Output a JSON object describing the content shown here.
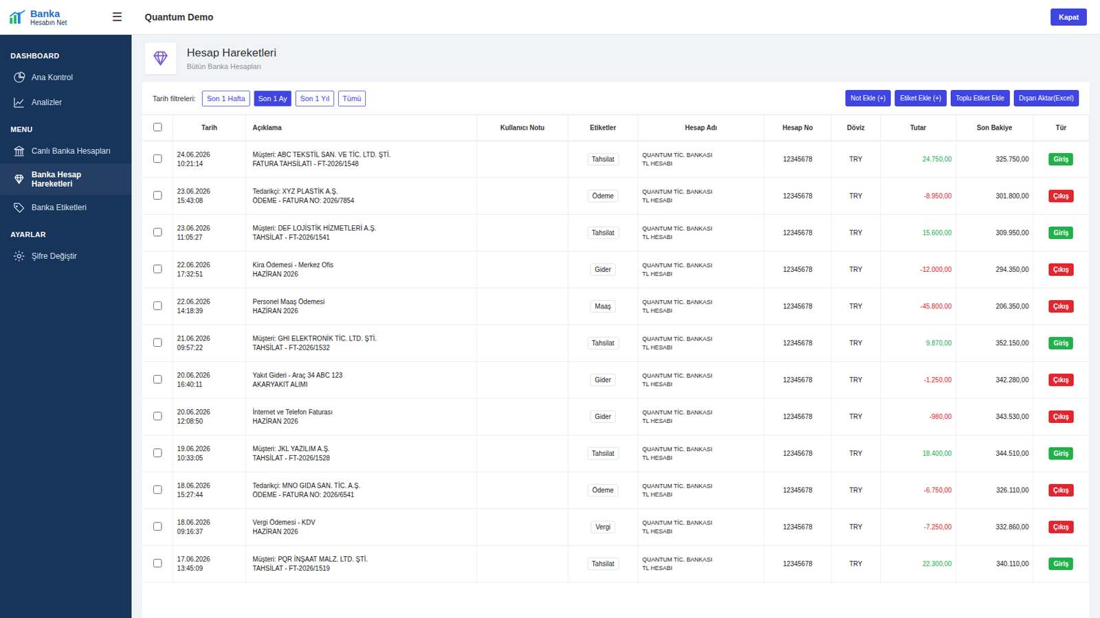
{
  "logo": {
    "title": "Banka",
    "subtitle": "Hesabın Net",
    "menu_toggle": "☰"
  },
  "sidebar": {
    "sections": [
      {
        "title": "DASHBOARD",
        "items": [
          {
            "label": "Ana Kontrol",
            "selected": false
          },
          {
            "label": "Analizler",
            "selected": false
          }
        ]
      },
      {
        "title": "MENU",
        "items": [
          {
            "label": "Canlı Banka Hesapları",
            "selected": false
          },
          {
            "label": "Banka Hesap Hareketleri",
            "selected": true
          },
          {
            "label": "Banka Etiketleri",
            "selected": false
          }
        ]
      },
      {
        "title": "AYARLAR",
        "items": [
          {
            "label": "Şifre Değiştir",
            "selected": false
          }
        ]
      }
    ]
  },
  "topbar": {
    "title": "Quantum Demo",
    "button": "Kapat"
  },
  "page": {
    "title": "Hesap Hareketleri",
    "subtitle": "Bütün Banka Hesapları"
  },
  "filters": {
    "label": "Tarih filtreleri:",
    "options": [
      {
        "label": "Son 1 Hafta",
        "selected": false
      },
      {
        "label": "Son 1 Ay",
        "selected": true
      },
      {
        "label": "Son 1 Yıl",
        "selected": false
      },
      {
        "label": "Tümü",
        "selected": false
      }
    ]
  },
  "actions": [
    "Not Ekle (+)",
    "Etiket Ekle (+)",
    "Toplu Etiket Ekle",
    "Dışarı Aktar(Excel)"
  ],
  "table": {
    "select_all_checked": false,
    "columns": [
      "Tarih",
      "Açıklama",
      "Kullanıcı Notu",
      "Etiketler",
      "Hesap Adı",
      "Hesap No",
      "Döviz",
      "Tutar",
      "Son Bakiye",
      "Tür"
    ],
    "rows": [
      {
        "checked": false,
        "date": "24.06.2026",
        "time": "10:21:14",
        "desc1": "Müşteri: ABC TEKSTİL SAN. VE TİC. LTD. ŞTİ.",
        "desc2": "FATURA TAHSİLATI - FT-2026/1548",
        "note": "",
        "tag": "Tahsilat",
        "account1": "QUANTUM TİC. BANKASI",
        "account2": "TL HESABI",
        "account_no": "12345678",
        "currency": "TRY",
        "amount": "24.750,00",
        "balance": "325.750,00",
        "type": "Giriş",
        "color": "#22b04b"
      },
      {
        "checked": false,
        "date": "23.06.2026",
        "time": "15:43:08",
        "desc1": "Tedarikçi: XYZ PLASTİK A.Ş.",
        "desc2": "ÖDEME - FATURA NO: 2026/7854",
        "note": "",
        "tag": "Ödeme",
        "account1": "QUANTUM TİC. BANKASI",
        "account2": "TL HESABI",
        "account_no": "12345678",
        "currency": "TRY",
        "amount": "-8.950,00",
        "balance": "301.800,00",
        "type": "Çıkış",
        "color": "#e0262f"
      },
      {
        "checked": false,
        "date": "23.06.2026",
        "time": "11:05:27",
        "desc1": "Müşteri: DEF LOJİSTİK HİZMETLERİ A.Ş.",
        "desc2": "TAHSİLAT - FT-2026/1541",
        "note": "",
        "tag": "Tahsilat",
        "account1": "QUANTUM TİC. BANKASI",
        "account2": "TL HESABI",
        "account_no": "12345678",
        "currency": "TRY",
        "amount": "15.600,00",
        "balance": "309.950,00",
        "type": "Giriş",
        "color": "#22b04b"
      },
      {
        "checked": false,
        "date": "22.06.2026",
        "time": "17:32:51",
        "desc1": "Kira Ödemesi - Merkez Ofis",
        "desc2": "HAZİRAN 2026",
        "note": "",
        "tag": "Gider",
        "account1": "QUANTUM TİC. BANKASI",
        "account2": "TL HESABI",
        "account_no": "12345678",
        "currency": "TRY",
        "amount": "-12.000,00",
        "balance": "294.350,00",
        "type": "Çıkış",
        "color": "#e0262f"
      },
      {
        "checked": false,
        "date": "22.06.2026",
        "time": "14:18:39",
        "desc1": "Personel Maaş Ödemesi",
        "desc2": "HAZİRAN 2026",
        "note": "",
        "tag": "Maaş",
        "account1": "QUANTUM TİC. BANKASI",
        "account2": "TL HESABI",
        "account_no": "12345678",
        "currency": "TRY",
        "amount": "-45.800,00",
        "balance": "206.350,00",
        "type": "Çıkış",
        "color": "#e0262f"
      },
      {
        "checked": false,
        "date": "21.06.2026",
        "time": "09:57:22",
        "desc1": "Müşteri: GHI ELEKTRONİK TİC. LTD. ŞTİ.",
        "desc2": "TAHSİLAT - FT-2026/1532",
        "note": "",
        "tag": "Tahsilat",
        "account1": "QUANTUM TİC. BANKASI",
        "account2": "TL HESABI",
        "account_no": "12345678",
        "currency": "TRY",
        "amount": "9.870,00",
        "balance": "352.150,00",
        "type": "Giriş",
        "color": "#22b04b"
      },
      {
        "checked": false,
        "date": "20.06.2026",
        "time": "16:40:11",
        "desc1": "Yakıt Gideri - Araç 34 ABC 123",
        "desc2": "AKARYAKIT ALIMI",
        "note": "",
        "tag": "Gider",
        "account1": "QUANTUM TİC. BANKASI",
        "account2": "TL HESABI",
        "account_no": "12345678",
        "currency": "TRY",
        "amount": "-1.250,00",
        "balance": "342.280,00",
        "type": "Çıkış",
        "color": "#e0262f"
      },
      {
        "checked": false,
        "date": "20.06.2026",
        "time": "12:08:50",
        "desc1": "İnternet ve Telefon Faturası",
        "desc2": "HAZİRAN 2026",
        "note": "",
        "tag": "Gider",
        "account1": "QUANTUM TİC. BANKASI",
        "account2": "TL HESABI",
        "account_no": "12345678",
        "currency": "TRY",
        "amount": "-980,00",
        "balance": "343.530,00",
        "type": "Çıkış",
        "color": "#e0262f"
      },
      {
        "checked": false,
        "date": "19.06.2026",
        "time": "10:33:05",
        "desc1": "Müşteri: JKL YAZILIM A.Ş.",
        "desc2": "TAHSİLAT - FT-2026/1528",
        "note": "",
        "tag": "Tahsilat",
        "account1": "QUANTUM TİC. BANKASI",
        "account2": "TL HESABI",
        "account_no": "12345678",
        "currency": "TRY",
        "amount": "18.400,00",
        "balance": "344.510,00",
        "type": "Giriş",
        "color": "#22b04b"
      },
      {
        "checked": false,
        "date": "18.06.2026",
        "time": "15:27:44",
        "desc1": "Tedarikçi: MNO GIDA SAN. TİC. A.Ş.",
        "desc2": "ÖDEME - FATURA NO: 2026/6541",
        "note": "",
        "tag": "Ödeme",
        "account1": "QUANTUM TİC. BANKASI",
        "account2": "TL HESABI",
        "account_no": "12345678",
        "currency": "TRY",
        "amount": "-6.750,00",
        "balance": "326.110,00",
        "type": "Çıkış",
        "color": "#e0262f"
      },
      {
        "checked": false,
        "date": "18.06.2026",
        "time": "09:16:37",
        "desc1": "Vergi Ödemesi - KDV",
        "desc2": "HAZİRAN 2026",
        "note": "",
        "tag": "Vergi",
        "account1": "QUANTUM TİC. BANKASI",
        "account2": "TL HESABI",
        "account_no": "12345678",
        "currency": "TRY",
        "amount": "-7.250,00",
        "balance": "332.860,00",
        "type": "Çıkış",
        "color": "#e0262f"
      },
      {
        "checked": false,
        "date": "17.06.2026",
        "time": "13:45:09",
        "desc1": "Müşteri: PQR İNŞAAT MALZ. LTD. ŞTİ.",
        "desc2": "TAHSİLAT - FT-2026/1519",
        "note": "",
        "tag": "Tahsilat",
        "account1": "QUANTUM TİC. BANKASI",
        "account2": "TL HESABI",
        "account_no": "12345678",
        "currency": "TRY",
        "amount": "22.300,00",
        "balance": "340.110,00",
        "type": "Giriş",
        "color": "#22b04b"
      }
    ]
  }
}
